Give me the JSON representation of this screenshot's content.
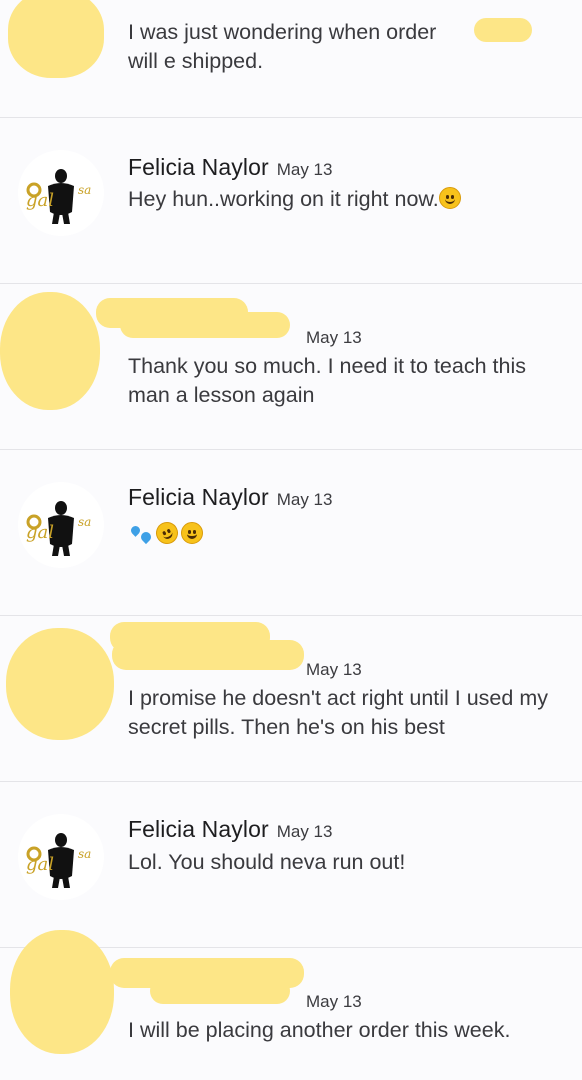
{
  "messages": [
    {
      "sender": "",
      "date": "",
      "text": "I was just wondering when order ",
      "text2": "will e shipped.",
      "has_avatar_logo": false
    },
    {
      "sender": "Felicia Naylor",
      "date": "May 13",
      "text": "Hey hun..working on it right now.",
      "emoji": "slightly-smiling-face",
      "has_avatar_logo": true
    },
    {
      "sender": "",
      "date": "May 13",
      "text": "Thank you so much. I need it to teach this man a lesson again",
      "has_avatar_logo": false
    },
    {
      "sender": "Felicia Naylor",
      "date": "May 13",
      "text": "",
      "emojis": [
        "sweat-droplets",
        "rolling-on-floor-laughing",
        "grinning-squinting-face"
      ],
      "has_avatar_logo": true
    },
    {
      "sender": "",
      "date": "May 13",
      "text": "I promise he doesn't act right until I used my secret pills. Then he's on his best",
      "has_avatar_logo": false
    },
    {
      "sender": "Felicia Naylor",
      "date": "May 13",
      "text": "Lol. You should neva run out!",
      "has_avatar_logo": true
    },
    {
      "sender": "",
      "date": "May 13",
      "text": "I will be placing another order this week.",
      "has_avatar_logo": false
    }
  ],
  "colors": {
    "redaction": "#fde687",
    "background": "#fbfbfd",
    "divider": "#e4e4e8",
    "logo_gold": "#c9a227"
  }
}
